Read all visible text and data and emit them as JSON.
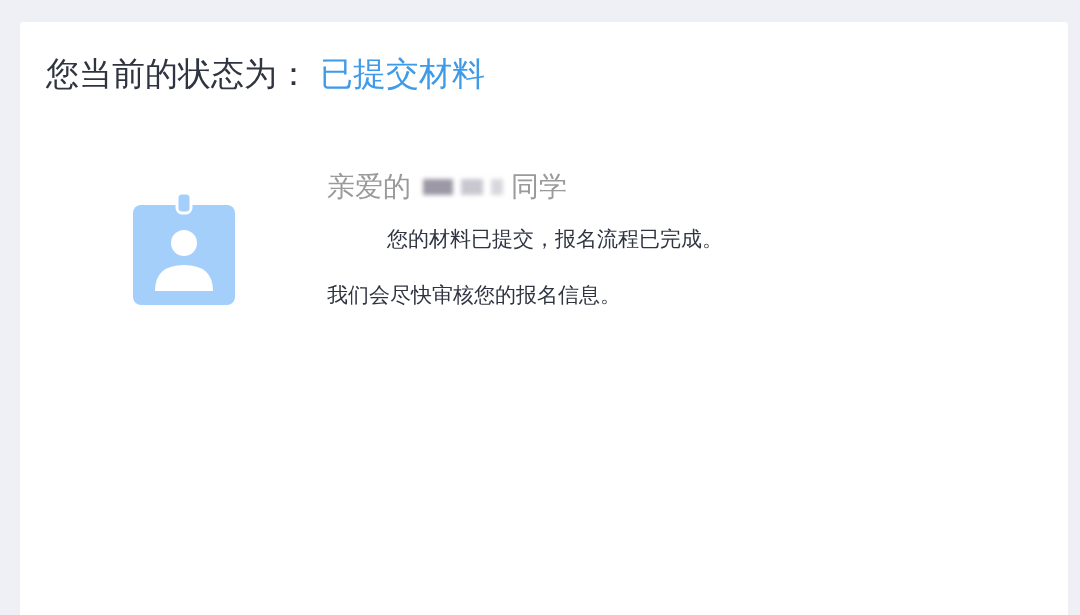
{
  "status": {
    "label": "您当前的状态为：",
    "value": "已提交材料"
  },
  "greeting": {
    "prefix": "亲爱的",
    "name_redacted": true,
    "suffix": "同学"
  },
  "message_lines": [
    "您的材料已提交，报名流程已完成。",
    "我们会尽快审核您的报名信息。"
  ]
}
